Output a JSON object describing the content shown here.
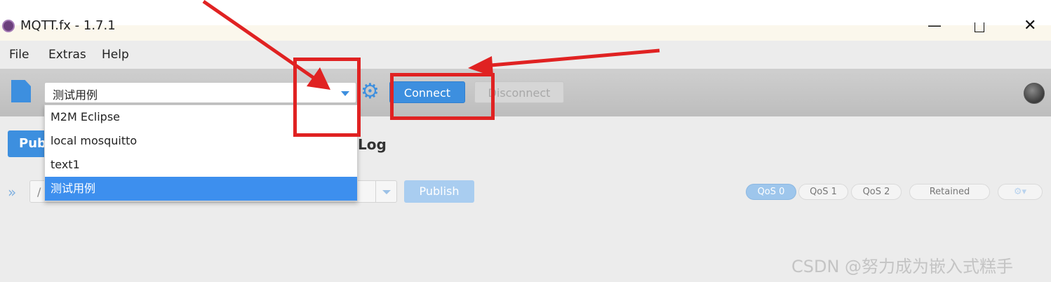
{
  "window": {
    "title": "MQTT.fx - 1.7.1",
    "min_glyph": "—",
    "close_glyph": "✕"
  },
  "menu": [
    "File",
    "Extras",
    "Help"
  ],
  "toolbar": {
    "profile_value": "测试用例",
    "connect_label": "Connect",
    "disconnect_label": "Disconnect"
  },
  "profiles_dropdown": {
    "items": [
      "M2M Eclipse",
      "local mosquitto",
      "text1",
      "测试用例"
    ],
    "selected_index": 3
  },
  "tabs": {
    "publish_label": "Pub",
    "log_label": "Log"
  },
  "publish_row": {
    "chevron": "»",
    "topic_value": "/",
    "publish_label": "Publish",
    "qos": [
      "QoS 0",
      "QoS 1",
      "QoS 2"
    ],
    "retained_label": "Retained",
    "options_glyph": "⚙▾"
  },
  "watermark": "CSDN @努力成为嵌入式糕手",
  "colors": {
    "accent": "#3d8fdf",
    "annotation": "#e02222",
    "selection": "#3d8fee"
  },
  "icons": [
    "app-icon",
    "document-icon",
    "gear-icon",
    "status-led",
    "chevron-icon",
    "options-icon"
  ]
}
